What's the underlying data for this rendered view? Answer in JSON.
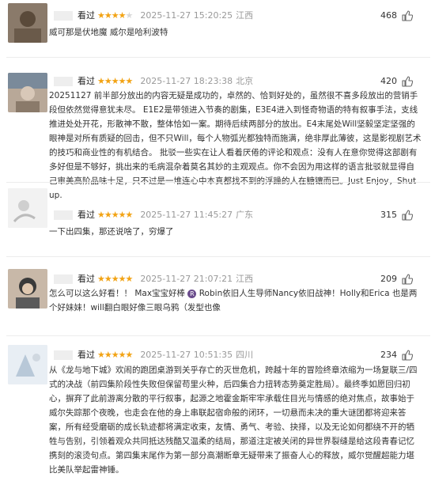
{
  "reviews": [
    {
      "action": "看过",
      "rating": 4,
      "time": "2025-11-27 15:20:25",
      "location": "江西",
      "votes": "468",
      "content": "威可那是伏地魔 威尔是哈利波特",
      "avatar_colors": [
        "#5a4a3a",
        "#9a8a7a"
      ]
    },
    {
      "action": "看过",
      "rating": 5,
      "time": "2025-11-27 18:23:38",
      "location": "北京",
      "votes": "420",
      "content": "20251127 前半部分放出的内容无疑是成功的，卓然的、恰到好处的，虽然很不喜多段放出的营销手段但依然觉得意犹未尽。 E1E2是带领进入节奏的剧集，E3E4进入到怪奇物语的特有叙事手法，支线推进处处开花，形散神不散，整体恰如一案。期待后续两部分的放出。E4末尾处Will坚毅坚定坚强的眼神是对所有质疑的回击，但不只Will，每个人物弧光都独特而施满，绝非厚此薄彼，这是影视剧艺术的技巧和商业性的有机结合。 批驳一些实在让人看着厌倦的评论和观点：没有人在意你觉得这部剧有多好但是不够好，挑出来的毛病混杂着莫名其妙的主观观点。你不会因为用这样的语言批驳就显得自己审美高阶品味十足，只不过是一堆连心中本真都找不到的浮躁的人在糖镶而已。Just Enjoy，Shut up.",
      "avatar_colors": [
        "#7a8a9a",
        "#c8b8a8"
      ]
    },
    {
      "action": "看过",
      "rating": 5,
      "time": "2025-11-27 11:45:27",
      "location": "广东",
      "votes": "315",
      "content": "一下出四集，那还说啥了，穷爆了",
      "avatar_colors": [
        "#d8d8d8",
        "#f0f0f0"
      ]
    },
    {
      "action": "看过",
      "rating": 5,
      "time": "2025-11-27 21:07:21",
      "location": "江西",
      "votes": "209",
      "content_prefix": "怎么可以这么好看！！ Max宝宝好棒",
      "content_suffix": "Robin依旧人生导师Nancy依旧战神！Holly和Erica 也是两个好妹妹！will翻白眼好像三眼乌鸦（发型也像",
      "avatar_colors": [
        "#3a3a3a",
        "#a89888"
      ]
    },
    {
      "action": "看过",
      "rating": 5,
      "time": "2025-11-27 10:51:35",
      "location": "四川",
      "votes": "234",
      "content": "从《龙与地下城》欢闹的跑团桌游到关乎存亡的灭世危机，跨越十年的冒险终章浓缩为一场复联三/四式的决战（前四集阶段性失败但保留苟里火种，后四集合力扭转态势奠定胜局）。最终季如愿回归初心，摒弃了此前游离分散的平行叙事，起源之地霍金斯牢牢承载住目光与情感的绝对焦点，故事始于威尔失踪那个夜晚，也走会在他的身上串联起宿命般的闭环，一切悬而未决的重大谜团都将迎来答案，所有经受磨砺的成长轨迹都将满定收束，友情、勇气、考验、抉择，以及无论如何都绕不开的牺牲与告别，引领着观众共同抵达残酷又温柔的结局，那道注定被关闭的异世界裂缝是给这段青春记忆携刻的滚烫句点。第四集末尾作为第一部分高潮断章无疑带来了振奋人心的释放，威尔觉醒超能力堪比美队举起雷神锤。",
      "avatar_colors": [
        "#b8c8d8",
        "#e8e8e8"
      ]
    }
  ]
}
